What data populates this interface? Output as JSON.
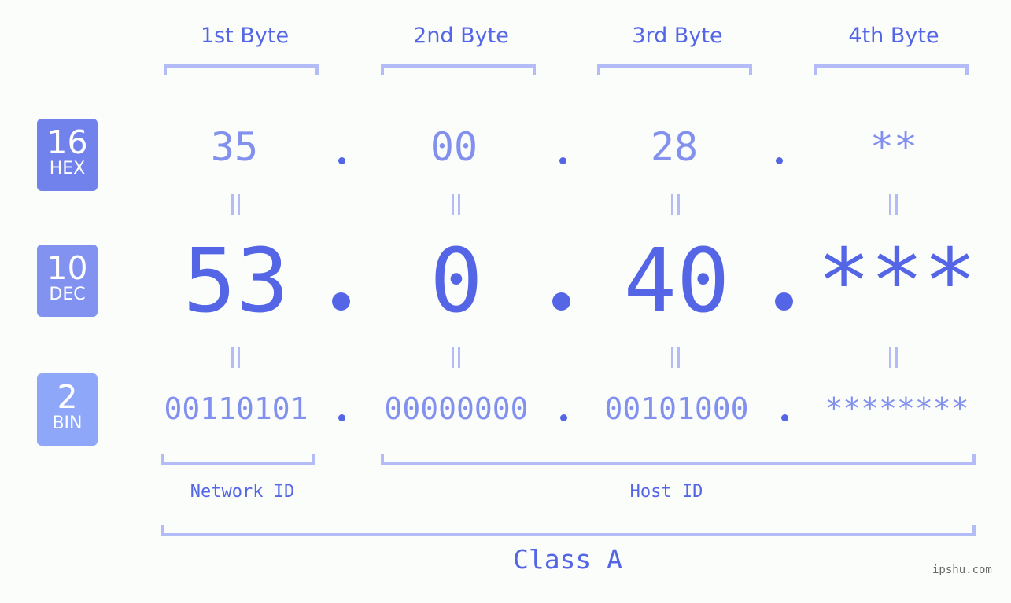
{
  "bytes": [
    {
      "label": "1st Byte",
      "hex": "35",
      "dec": "53",
      "bin": "00110101"
    },
    {
      "label": "2nd Byte",
      "hex": "00",
      "dec": "0",
      "bin": "00000000"
    },
    {
      "label": "3rd Byte",
      "hex": "28",
      "dec": "40",
      "bin": "00101000"
    },
    {
      "label": "4th Byte",
      "hex": "**",
      "dec": "***",
      "bin": "********"
    }
  ],
  "bases": {
    "hex": {
      "number": "16",
      "name": "HEX",
      "color": "#7282ec"
    },
    "dec": {
      "number": "10",
      "name": "DEC",
      "color": "#8292f0"
    },
    "bin": {
      "number": "2",
      "name": "BIN",
      "color": "#8fa7f8"
    }
  },
  "segments": {
    "network": "Network ID",
    "host": "Host ID"
  },
  "class_label": "Class A",
  "watermark": "ipshu.com",
  "colors": {
    "accent": "#5466e6",
    "light_accent": "#8290ee",
    "bracket": "#b4bcf8",
    "background": "#fbfdfb"
  }
}
